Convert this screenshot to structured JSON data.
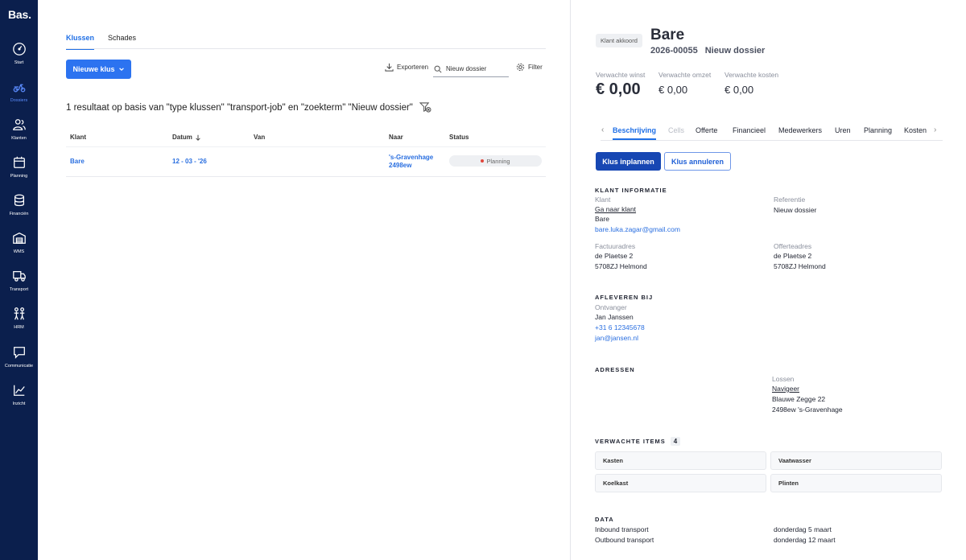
{
  "app": {
    "logo": "Bas."
  },
  "sidebar": {
    "items": [
      {
        "label": "Start",
        "icon": "gauge-icon"
      },
      {
        "label": "Dossiers",
        "icon": "scooter-icon"
      },
      {
        "label": "Klanten",
        "icon": "users-icon"
      },
      {
        "label": "Planning",
        "icon": "calendar-icon"
      },
      {
        "label": "Financiën",
        "icon": "coins-icon"
      },
      {
        "label": "WMS",
        "icon": "warehouse-icon"
      },
      {
        "label": "Transport",
        "icon": "truck-icon"
      },
      {
        "label": "HRM",
        "icon": "people-icon"
      },
      {
        "label": "Communicatie",
        "icon": "chat-icon"
      },
      {
        "label": "Inzicht",
        "icon": "chart-line-icon"
      }
    ],
    "active": "Dossiers",
    "bg_color": "#0b1f4d"
  },
  "main": {
    "tabs": [
      {
        "label": "Klussen"
      },
      {
        "label": "Schades"
      }
    ],
    "new_button": "Nieuwe klus",
    "export_label": "Exporteren",
    "search_value": "Nieuw dossier",
    "filter_label": "Filter",
    "result_text": "1 resultaat op basis van \"type klussen\" \"transport-job\" en \"zoekterm\" \"Nieuw dossier\"",
    "columns": {
      "klant": "Klant",
      "datum": "Datum",
      "van": "Van",
      "naar": "Naar",
      "status": "Status"
    },
    "rows": [
      {
        "klant": "Bare",
        "datum": "12 - 03 - '26",
        "van": "",
        "naar_line1": "'s-Gravenhage",
        "naar_line2": "2498ew",
        "status": "Planning"
      }
    ],
    "accent_color": "#2c73f0"
  },
  "detail": {
    "badge": "Klant akkoord",
    "title": "Bare",
    "number": "2026-00055",
    "subtitle": "Nieuw dossier",
    "metrics": [
      {
        "label": "Verwachte winst",
        "value": "€ 0,00"
      },
      {
        "label": "Verwachte omzet",
        "value": "€ 0,00"
      },
      {
        "label": "Verwachte kosten",
        "value": "€ 0,00"
      }
    ],
    "tabs": [
      "Beschrijving",
      "Cells",
      "Offerte",
      "Financieel",
      "Medewerkers",
      "Uren",
      "Planning",
      "Kosten"
    ],
    "active_tab": "Beschrijving",
    "btn_plan": "Klus inplannen",
    "btn_cancel": "Klus annuleren",
    "klant_info": {
      "heading": "KLANT INFORMATIE",
      "klant_label": "Klant",
      "klant_link": "Ga naar klant",
      "klant_name": "Bare",
      "klant_email": "bare.luka.zagar@gmail.com",
      "referentie_label": "Referentie",
      "referentie_value": "Nieuw dossier",
      "factuur_label": "Factuuradres",
      "factuur_line1": "de Plaetse 2",
      "factuur_line2": "5708ZJ Helmond",
      "offerte_label": "Offerteadres",
      "offerte_line1": "de Plaetse 2",
      "offerte_line2": "5708ZJ Helmond"
    },
    "afleveren": {
      "heading": "AFLEVEREN BIJ",
      "ontvanger_label": "Ontvanger",
      "name": "Jan Janssen",
      "phone": "+31 6 12345678",
      "email": "jan@jansen.nl"
    },
    "adressen": {
      "heading": "ADRESSEN",
      "lossen_label": "Lossen",
      "navigeer": "Navigeer",
      "line1": "Blauwe Zegge 22",
      "line2": "2498ew 's-Gravenhage"
    },
    "items": {
      "heading": "VERWACHTE ITEMS",
      "count": "4",
      "list": [
        "Kasten",
        "Vaatwasser",
        "Koelkast",
        "Plinten"
      ]
    },
    "data": {
      "heading": "DATA",
      "rows": [
        {
          "label": "Inbound transport",
          "value": "donderdag 5 maart"
        },
        {
          "label": "Outbound transport",
          "value": "donderdag 12 maart"
        }
      ]
    }
  }
}
